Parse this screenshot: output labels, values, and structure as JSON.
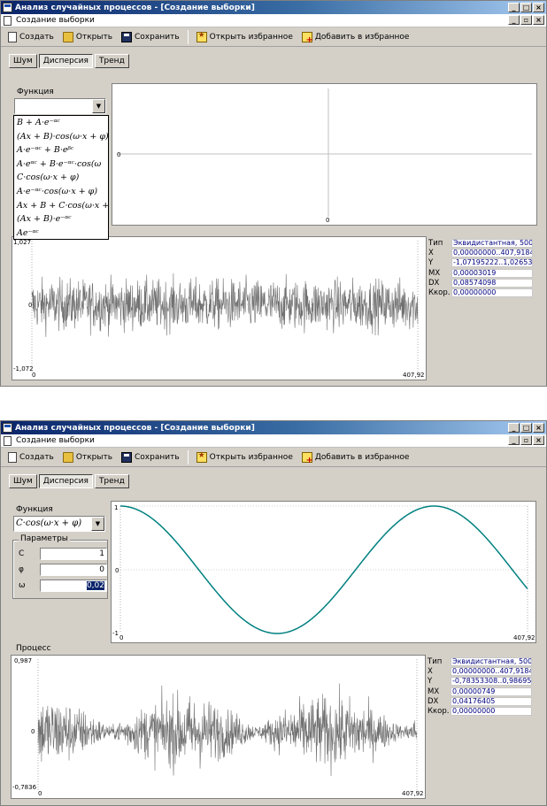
{
  "window": {
    "title": "Анализ случайных процессов - [Создание выборки]",
    "mdi_title": "Создание выборки"
  },
  "toolbar": {
    "create": "Создать",
    "open": "Открыть",
    "save": "Сохранить",
    "open_fav": "Открыть избранное",
    "add_fav": "Добавить в избранное"
  },
  "tabs": [
    {
      "label": "Шум"
    },
    {
      "label": "Дисперсия"
    },
    {
      "label": "Тренд"
    }
  ],
  "panel1": {
    "function_label": "Функция",
    "function_value": "",
    "dropdown": [
      "B + A·e⁻ᵅᶜ",
      "(Ax + B)·cos(ω·x + φ)",
      "A·e⁻ᵅᶜ + B·eᵝᶜ",
      "A·eᵅᶜ + B·e⁻ᵅᶜ·cos(ω",
      "C·cos(ω·x + φ)",
      "A·e⁻ᵅᶜ·cos(ω·x + φ)",
      "Ax + B + C·cos(ω·x + φ",
      "(Ax + B)·e⁻ᵅᶜ",
      "Ae⁻ᵅᶜ"
    ],
    "func_plot": {
      "y_zero": "0",
      "x_zero": "0"
    },
    "process": {
      "y_max": "1,027",
      "y_zero": "0",
      "y_min": "-1,072",
      "x_min": "0",
      "x_max": "407,92"
    },
    "info": {
      "type_label": "Тип",
      "type_value": "Эквидистантная, 5000",
      "x_label": "X",
      "x_value": "0,00000000..407,91840",
      "y_label": "Y",
      "y_value": "-1,07195222..1,026534",
      "mx_label": "MX",
      "mx_value": "0,00003019",
      "dx_label": "DX",
      "dx_value": "0,08574098",
      "kcorr_label": "Ккор.",
      "kcorr_value": "0,00000000"
    }
  },
  "panel2": {
    "function_label": "Функция",
    "function_value": "C·cos(ω·x + φ)",
    "params_title": "Параметры",
    "params": [
      {
        "name": "C",
        "value": "1"
      },
      {
        "name": "φ",
        "value": "0"
      },
      {
        "name": "ω",
        "value": "0,02"
      }
    ],
    "func_plot": {
      "y_max": "1",
      "y_zero": "0",
      "y_min": "-1",
      "x_min": "0",
      "x_max": "407,92"
    },
    "process_label": "Процесс",
    "process": {
      "y_max": "0,987",
      "y_zero": "0",
      "y_min": "-0,7836",
      "x_min": "0",
      "x_max": "407,92"
    },
    "info": {
      "type_label": "Тип",
      "type_value": "Эквидистантная, 5000",
      "x_label": "X",
      "x_value": "0,00000000..407,91840",
      "y_label": "Y",
      "y_value": "-0,78353308..0,986955",
      "mx_label": "MX",
      "mx_value": "0,00000749",
      "dx_label": "DX",
      "dx_value": "0,04176405",
      "kcorr_label": "Ккор.",
      "kcorr_value": "0,00000000"
    }
  },
  "chart_data": [
    {
      "type": "line",
      "series": [
        {
          "name": "C·cos(ω·x + φ)",
          "function": "1·cos(0.02·x + 0)"
        }
      ],
      "xlim": [
        0,
        407.92
      ],
      "ylim": [
        -1,
        1
      ]
    },
    {
      "type": "line",
      "series": [
        {
          "name": "Процесс",
          "points": 5000
        }
      ],
      "xlim": [
        0,
        407.92
      ],
      "ylim": [
        -1.072,
        1.027
      ]
    },
    {
      "type": "line",
      "series": [
        {
          "name": "Процесс",
          "points": 5000
        }
      ],
      "xlim": [
        0,
        407.92
      ],
      "ylim": [
        -0.7836,
        0.987
      ]
    }
  ],
  "colors": {
    "title_start": "#0a246a",
    "title_end": "#a6caf0",
    "face": "#d4d0c8",
    "cosine": "#008080",
    "noise": "#707070",
    "value_text": "#000080"
  }
}
